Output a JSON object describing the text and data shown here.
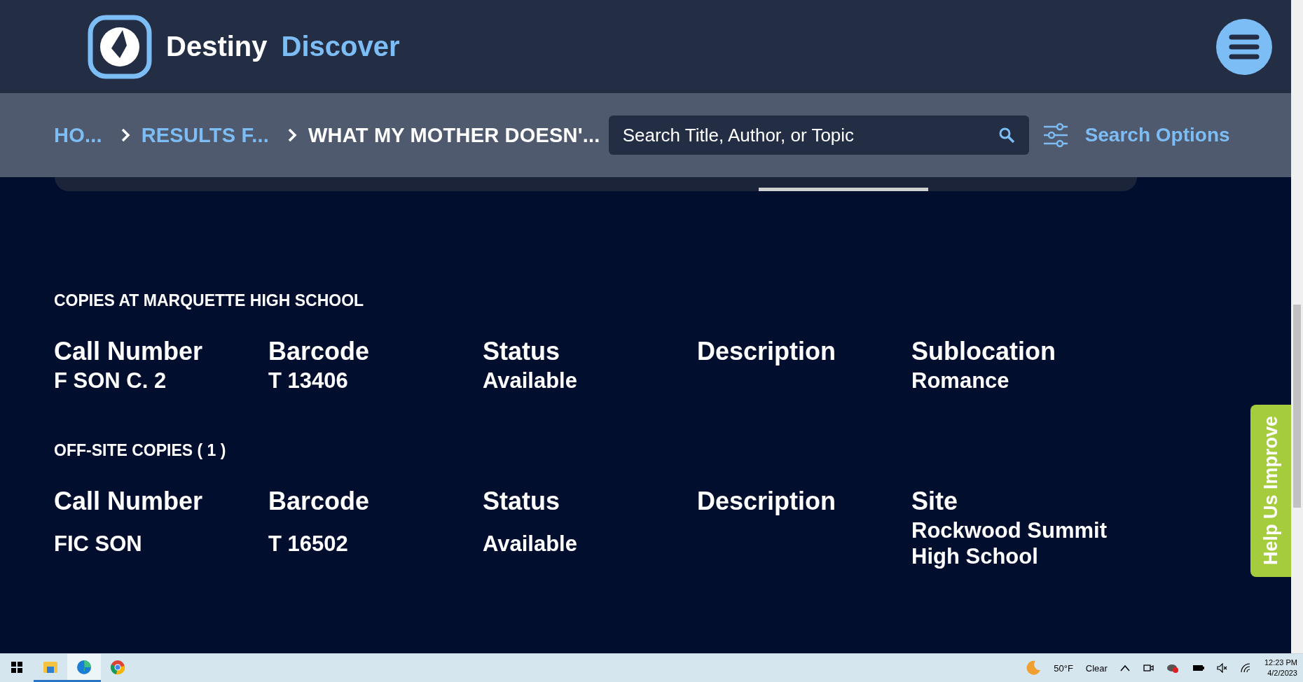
{
  "header": {
    "brand_first": "Destiny",
    "brand_second": "Discover"
  },
  "breadcrumbs": [
    {
      "label": "HO...",
      "current": false
    },
    {
      "label": "RESULTS F...",
      "current": false
    },
    {
      "label": "WHAT MY MOTHER DOESN'...",
      "current": true
    }
  ],
  "search": {
    "placeholder": "Search Title, Author, or Topic"
  },
  "search_options": "Search Options",
  "sections": [
    {
      "heading": "COPIES AT MARQUETTE HIGH SCHOOL",
      "columns": [
        {
          "header": "Call Number",
          "value": "F SON C. 2"
        },
        {
          "header": "Barcode",
          "value": "T 13406"
        },
        {
          "header": "Status",
          "value": "Available"
        },
        {
          "header": "Description"
        },
        {
          "header": "Sublocation",
          "value": "Romance"
        }
      ]
    },
    {
      "heading": "OFF-SITE COPIES ( 1 )",
      "columns": [
        {
          "header": "Call Number",
          "value": "FIC SON"
        },
        {
          "header": "Barcode",
          "value": "T 16502"
        },
        {
          "header": "Status",
          "value": "Available"
        },
        {
          "header": "Description"
        },
        {
          "header": "Site",
          "value": "Rockwood Summit High School"
        }
      ]
    }
  ],
  "feedback_tab": "Help Us Improve",
  "taskbar": {
    "apps": [
      {
        "kind": "explorer",
        "running": true,
        "selected": false
      },
      {
        "kind": "edge",
        "running": true,
        "selected": true
      },
      {
        "kind": "chrome",
        "running": false,
        "selected": false
      }
    ],
    "temperature": "50°F",
    "weather": "Clear",
    "time": "12:23 PM",
    "date": "4/2/2023"
  }
}
